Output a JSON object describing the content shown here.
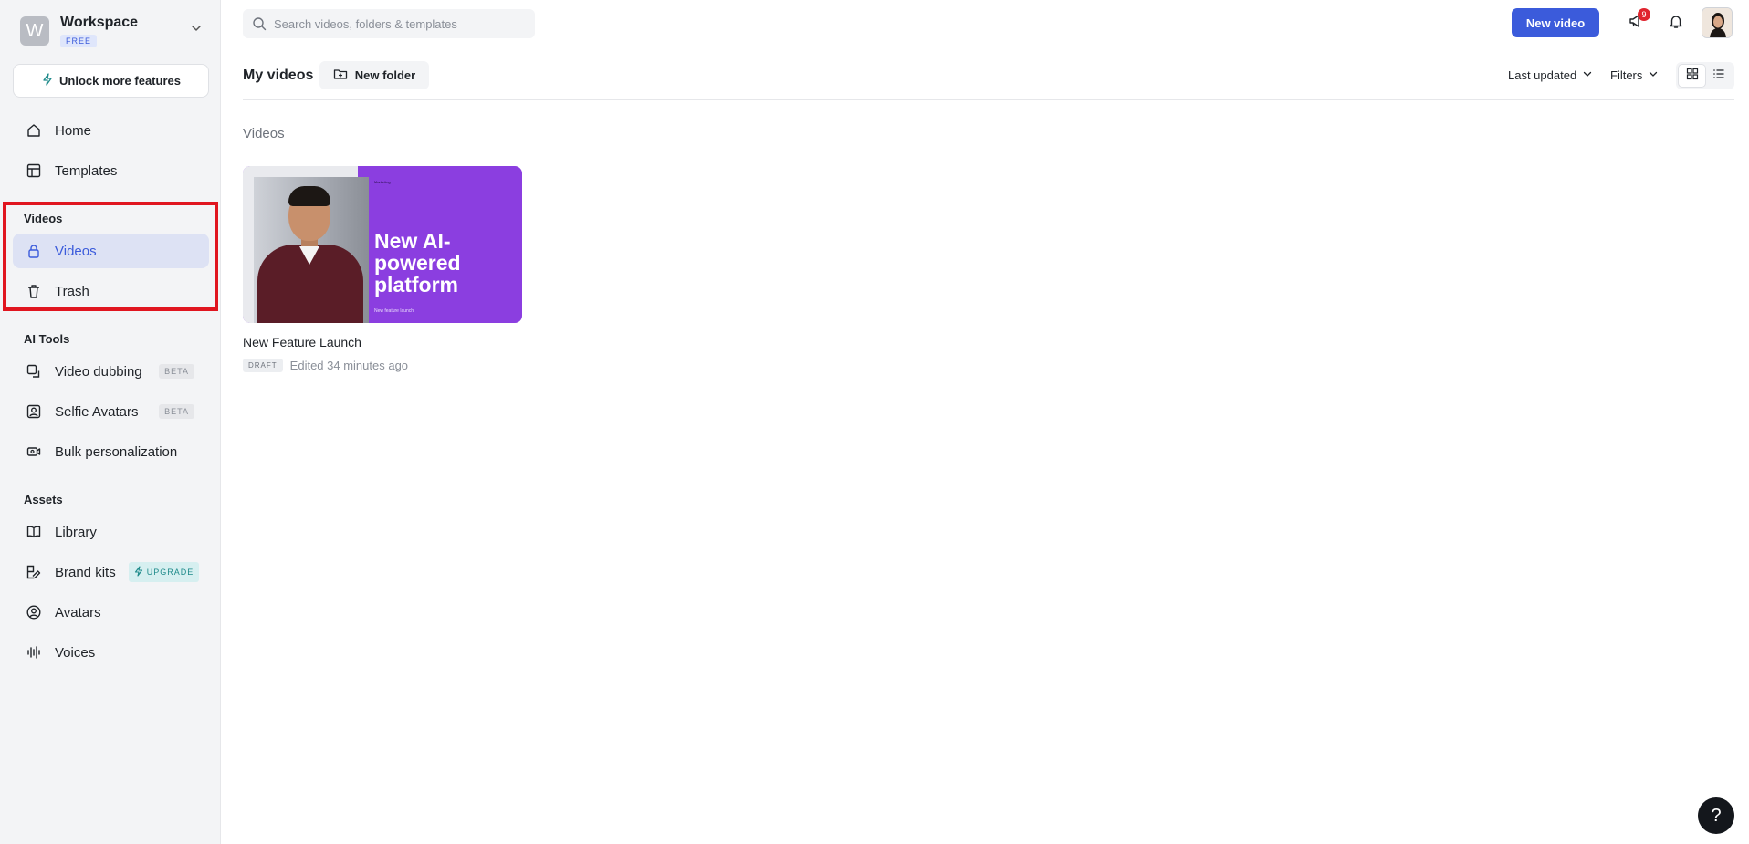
{
  "workspace": {
    "initial": "W",
    "name": "Workspace",
    "plan": "FREE"
  },
  "sidebar": {
    "unlock_label": "Unlock more features",
    "top_items": [
      {
        "label": "Home",
        "icon": "home-icon"
      },
      {
        "label": "Templates",
        "icon": "templates-icon"
      }
    ],
    "sections": {
      "videos": {
        "label": "Videos",
        "items": [
          {
            "label": "Videos",
            "icon": "lock-icon",
            "active": true
          },
          {
            "label": "Trash",
            "icon": "trash-icon"
          }
        ]
      },
      "ai_tools": {
        "label": "AI Tools",
        "items": [
          {
            "label": "Video dubbing",
            "icon": "dubbing-icon",
            "tag": "BETA"
          },
          {
            "label": "Selfie Avatars",
            "icon": "selfie-avatar-icon",
            "tag": "BETA"
          },
          {
            "label": "Bulk personalization",
            "icon": "bulk-icon"
          }
        ]
      },
      "assets": {
        "label": "Assets",
        "items": [
          {
            "label": "Library",
            "icon": "book-icon"
          },
          {
            "label": "Brand kits",
            "icon": "brand-kit-icon",
            "tag": "UPGRADE"
          },
          {
            "label": "Avatars",
            "icon": "avatar-icon"
          },
          {
            "label": "Voices",
            "icon": "waveform-icon"
          }
        ]
      }
    }
  },
  "topbar": {
    "search_placeholder": "Search videos, folders & templates",
    "new_video_label": "New video",
    "announcements_count": "9"
  },
  "toolbar": {
    "title": "My videos",
    "new_folder_label": "New folder",
    "sort_label": "Last updated",
    "filters_label": "Filters"
  },
  "content": {
    "section_label": "Videos",
    "videos": [
      {
        "title": "New Feature Launch",
        "status": "DRAFT",
        "edited": "Edited 34 minutes ago",
        "thumbnail": {
          "top_text": "Marketing",
          "headline": "New AI-powered platform",
          "bottom_text": "New feature launch"
        }
      }
    ]
  },
  "help_label": "?",
  "colors": {
    "accent": "#3b5bdb",
    "highlight": "#e0151f",
    "thumbnail_bg": "#8b3ee0"
  }
}
